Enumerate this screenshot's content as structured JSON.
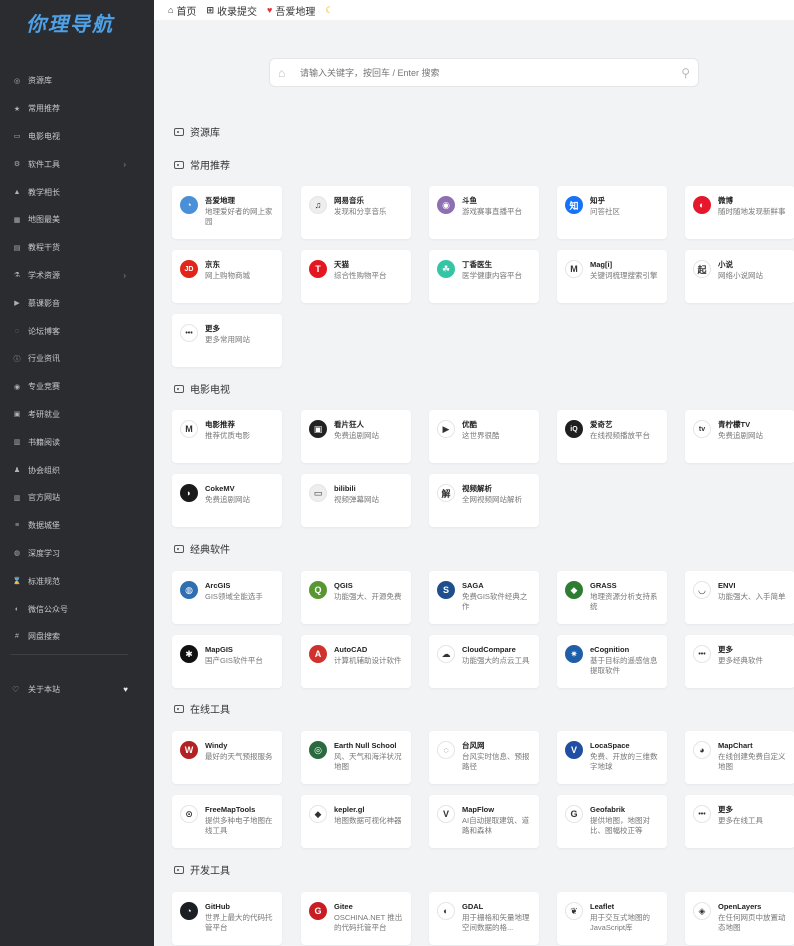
{
  "sidebar": {
    "logo": "你理导航",
    "items": [
      {
        "label": "资源库",
        "icon": "target-icon",
        "arrow": false
      },
      {
        "label": "常用推荐",
        "icon": "star-icon",
        "arrow": false
      },
      {
        "label": "电影电视",
        "icon": "monitor-icon",
        "arrow": false
      },
      {
        "label": "软件工具",
        "icon": "cogs-icon",
        "arrow": true
      },
      {
        "label": "教学相长",
        "icon": "graduation-cap-icon",
        "arrow": false
      },
      {
        "label": "地图最美",
        "icon": "map-icon",
        "arrow": false
      },
      {
        "label": "教程干货",
        "icon": "file-icon",
        "arrow": false
      },
      {
        "label": "学术资源",
        "icon": "flask-icon",
        "arrow": true
      },
      {
        "label": "慕课影音",
        "icon": "video-icon",
        "arrow": false
      },
      {
        "label": "论坛博客",
        "icon": "forum-icon",
        "arrow": false
      },
      {
        "label": "行业资讯",
        "icon": "info-icon",
        "arrow": false
      },
      {
        "label": "专业竞赛",
        "icon": "gamepad-icon",
        "arrow": false
      },
      {
        "label": "考研就业",
        "icon": "money-icon",
        "arrow": false
      },
      {
        "label": "书籍阅读",
        "icon": "book-icon",
        "arrow": false
      },
      {
        "label": "协会组织",
        "icon": "users-icon",
        "arrow": false
      },
      {
        "label": "官方网站",
        "icon": "institution-icon",
        "arrow": false
      },
      {
        "label": "数据城堡",
        "icon": "database-icon",
        "arrow": false
      },
      {
        "label": "深度学习",
        "icon": "globe-icon",
        "arrow": false
      },
      {
        "label": "标准规范",
        "icon": "hourglass-icon",
        "arrow": false
      },
      {
        "label": "微信公众号",
        "icon": "wechat-icon",
        "arrow": false
      },
      {
        "label": "网盘搜索",
        "icon": "hash-icon",
        "arrow": false
      }
    ],
    "about": "关于本站"
  },
  "topbar": {
    "home": "首页",
    "submit": "收录提交",
    "love": "吾爱地理"
  },
  "search": {
    "placeholder": "请输入关键字，按回车 / Enter 搜索"
  },
  "sections": {
    "ziyuanku": "资源库",
    "changyong": "常用推荐",
    "dianying": "电影电视",
    "jingdian": "经典软件",
    "zaixian": "在线工具",
    "kaifa": "开发工具"
  },
  "cards": {
    "changyong": [
      {
        "title": "吾爱地理",
        "desc": "地理爱好者的网上家园",
        "icon": "globe-icon",
        "color": "#4a90d9",
        "glyph": "◔"
      },
      {
        "title": "网易音乐",
        "desc": "发现和分享音乐",
        "icon": "netease-icon",
        "color": "#eeeeee",
        "glyph": "♫"
      },
      {
        "title": "斗鱼",
        "desc": "游戏赛事直播平台",
        "icon": "douyu-icon",
        "color": "#8e6fb2",
        "glyph": "◉"
      },
      {
        "title": "知乎",
        "desc": "问答社区",
        "icon": "zhihu-icon",
        "color": "#1772f6",
        "glyph": "知"
      },
      {
        "title": "微博",
        "desc": "随时随地发现新鲜事",
        "icon": "weibo-icon",
        "color": "#e6162d",
        "glyph": "◐"
      },
      {
        "title": "京东",
        "desc": "网上购物商城",
        "icon": "jd-icon",
        "color": "#e1251b",
        "glyph": "JD"
      },
      {
        "title": "天猫",
        "desc": "综合性购物平台",
        "icon": "tmall-icon",
        "color": "#e4161f",
        "glyph": "T"
      },
      {
        "title": "丁香医生",
        "desc": "医学健康内容平台",
        "icon": "dxy-icon",
        "color": "#34c5a5",
        "glyph": "☘"
      },
      {
        "title": "Mag[i]",
        "desc": "关键词梳理搜索引擎",
        "icon": "magi-icon",
        "color": "#ffffff",
        "glyph": "M"
      },
      {
        "title": "小说",
        "desc": "网络小说网站",
        "icon": "novel-icon",
        "color": "#ffffff",
        "glyph": "起"
      },
      {
        "title": "更多",
        "desc": "更多常用网站",
        "icon": "more-icon",
        "color": "#ffffff",
        "glyph": "•••"
      }
    ],
    "dianying": [
      {
        "title": "电影推荐",
        "desc": "推荐优质电影",
        "icon": "movie-icon",
        "color": "#ffffff",
        "glyph": "M"
      },
      {
        "title": "看片狂人",
        "desc": "免费追剧网站",
        "icon": "kpkr-icon",
        "color": "#222222",
        "glyph": "▣"
      },
      {
        "title": "优酷",
        "desc": "这世界很酷",
        "icon": "youku-icon",
        "color": "#ffffff",
        "glyph": "▶"
      },
      {
        "title": "爱奇艺",
        "desc": "在线视频播放平台",
        "icon": "iqiyi-icon",
        "color": "#1f1f1f",
        "glyph": "iQ"
      },
      {
        "title": "青柠檬TV",
        "desc": "免费追剧网站",
        "icon": "tv-icon",
        "color": "#ffffff",
        "glyph": "tv"
      },
      {
        "title": "CokeMV",
        "desc": "免费追剧网站",
        "icon": "cokemv-icon",
        "color": "#1a1a1a",
        "glyph": "◗"
      },
      {
        "title": "bilibili",
        "desc": "视频弹幕网站",
        "icon": "bilibili-icon",
        "color": "#eeeeee",
        "glyph": "▭"
      },
      {
        "title": "视频解析",
        "desc": "全网视频网站解析",
        "icon": "parse-icon",
        "color": "#ffffff",
        "glyph": "解"
      }
    ],
    "jingdian": [
      {
        "title": "ArcGIS",
        "desc": "GIS领域全能选手",
        "icon": "arcgis-icon",
        "color": "#2f6fb0",
        "glyph": "◍"
      },
      {
        "title": "QGIS",
        "desc": "功能强大、开源免费",
        "icon": "qgis-icon",
        "color": "#589632",
        "glyph": "Q"
      },
      {
        "title": "SAGA",
        "desc": "免费GIS软件经典之作",
        "icon": "saga-icon",
        "color": "#1e4e8c",
        "glyph": "S"
      },
      {
        "title": "GRASS",
        "desc": "地理资源分析支持系统",
        "icon": "grass-icon",
        "color": "#2e7d32",
        "glyph": "◆"
      },
      {
        "title": "ENVI",
        "desc": "功能强大、入手简单",
        "icon": "envi-icon",
        "color": "#ffffff",
        "glyph": "◡"
      },
      {
        "title": "MapGIS",
        "desc": "国产GIS软件平台",
        "icon": "mapgis-icon",
        "color": "#111111",
        "glyph": "✱"
      },
      {
        "title": "AutoCAD",
        "desc": "计算机辅助设计软件",
        "icon": "autocad-icon",
        "color": "#d0312d",
        "glyph": "A"
      },
      {
        "title": "CloudCompare",
        "desc": "功能强大的点云工具",
        "icon": "cloudcompare-icon",
        "color": "#ffffff",
        "glyph": "☁"
      },
      {
        "title": "eCognition",
        "desc": "基于目标的遥感信息提取软件",
        "icon": "ecognition-icon",
        "color": "#1f5fa8",
        "glyph": "✷"
      },
      {
        "title": "更多",
        "desc": "更多经典软件",
        "icon": "more-icon",
        "color": "#ffffff",
        "glyph": "•••"
      }
    ],
    "zaixian": [
      {
        "title": "Windy",
        "desc": "最好的天气预报服务",
        "icon": "windy-icon",
        "color": "#b22222",
        "glyph": "W"
      },
      {
        "title": "Earth Null School",
        "desc": "风、天气和海洋状况地图",
        "icon": "earth-icon",
        "color": "#2b6a3f",
        "glyph": "◎"
      },
      {
        "title": "台风网",
        "desc": "台风实时信息、预报路径",
        "icon": "typhoon-icon",
        "color": "#ffffff",
        "glyph": "◌"
      },
      {
        "title": "LocaSpace",
        "desc": "免费、开放的三维数字地球",
        "icon": "locaspace-icon",
        "color": "#1f4ea3",
        "glyph": "V"
      },
      {
        "title": "MapChart",
        "desc": "在线创建免费自定义地图",
        "icon": "mapchart-icon",
        "color": "#ffffff",
        "glyph": "◕"
      },
      {
        "title": "FreeMapTools",
        "desc": "提供多种电子地图在线工具",
        "icon": "pin-icon",
        "color": "#ffffff",
        "glyph": "⊙"
      },
      {
        "title": "kepler.gl",
        "desc": "地图数据可视化神器",
        "icon": "kepler-icon",
        "color": "#ffffff",
        "glyph": "◆"
      },
      {
        "title": "MapFlow",
        "desc": "AI自动提取建筑、道路和森林",
        "icon": "mapflow-icon",
        "color": "#ffffff",
        "glyph": "V"
      },
      {
        "title": "Geofabrik",
        "desc": "提供地图，地图对比、图幅校正等",
        "icon": "geofabrik-icon",
        "color": "#ffffff",
        "glyph": "G"
      },
      {
        "title": "更多",
        "desc": "更多在线工具",
        "icon": "more-icon",
        "color": "#ffffff",
        "glyph": "•••"
      }
    ],
    "kaifa": [
      {
        "title": "GitHub",
        "desc": "世界上最大的代码托管平台",
        "icon": "github-icon",
        "color": "#1b1f23",
        "glyph": "◔"
      },
      {
        "title": "Gitee",
        "desc": "OSCHINA.NET 推出的代码托管平台",
        "icon": "gitee-icon",
        "color": "#c71d23",
        "glyph": "G"
      },
      {
        "title": "GDAL",
        "desc": "用于栅格和矢量地理空间数据的格...",
        "icon": "gdal-icon",
        "color": "#ffffff",
        "glyph": "◐"
      },
      {
        "title": "Leaflet",
        "desc": "用于交互式地图的JavaScript库",
        "icon": "leaflet-icon",
        "color": "#ffffff",
        "glyph": "❦"
      },
      {
        "title": "OpenLayers",
        "desc": "在任何网页中放置动态地图",
        "icon": "openlayers-icon",
        "color": "#ffffff",
        "glyph": "◈"
      }
    ]
  }
}
